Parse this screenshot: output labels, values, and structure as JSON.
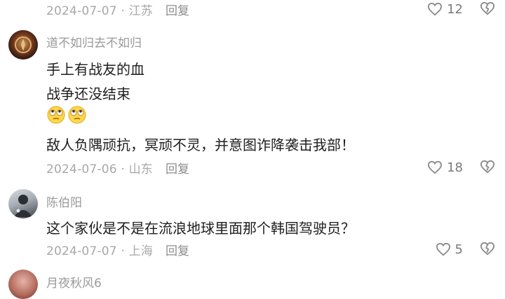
{
  "comments": [
    {
      "date_loc": "2024-07-07 · 江苏",
      "reply_label": "回复",
      "likes": "12"
    },
    {
      "username": "道不如归去不如归",
      "lines": [
        "手上有战友的血",
        "战争还没结束"
      ],
      "emoji": [
        "eye-roll-emoji",
        "eye-roll-emoji"
      ],
      "line_after": "敌人负隅顽抗，冥顽不灵，并意图诈降袭击我部！",
      "date_loc": "2024-07-06 · 山东",
      "reply_label": "回复",
      "likes": "18"
    },
    {
      "username": "陈伯阳",
      "lines": [
        "这个家伙是不是在流浪地球里面那个韩国驾驶员？"
      ],
      "date_loc": "2024-07-07 · 上海",
      "reply_label": "回复",
      "likes": "5"
    },
    {
      "username": "月夜秋风6"
    }
  ],
  "colors": {
    "meta": "#a8a8a8",
    "text": "#1e1e1e",
    "icon": "#7a7a7a"
  }
}
